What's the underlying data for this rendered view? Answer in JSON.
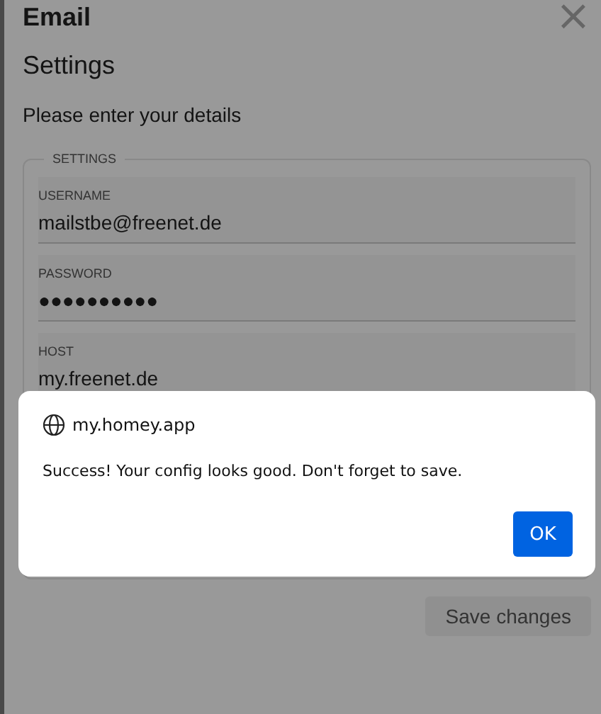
{
  "window": {
    "title": "Email",
    "close": "×"
  },
  "heading": "Settings",
  "intro": "Please enter your details",
  "fieldset": {
    "legend": "SETTINGS",
    "fields": [
      {
        "label": "USERNAME",
        "value": "mailstbe@freenet.de"
      },
      {
        "label": "PASSWORD",
        "value": "●●●●●●●●●●"
      },
      {
        "label": "HOST",
        "value": "my.freenet.de"
      }
    ]
  },
  "save_button": "Save changes",
  "alert": {
    "origin": "my.homey.app",
    "message": "Success! Your config looks good. Don't forget to save.",
    "ok_button": "OK"
  }
}
